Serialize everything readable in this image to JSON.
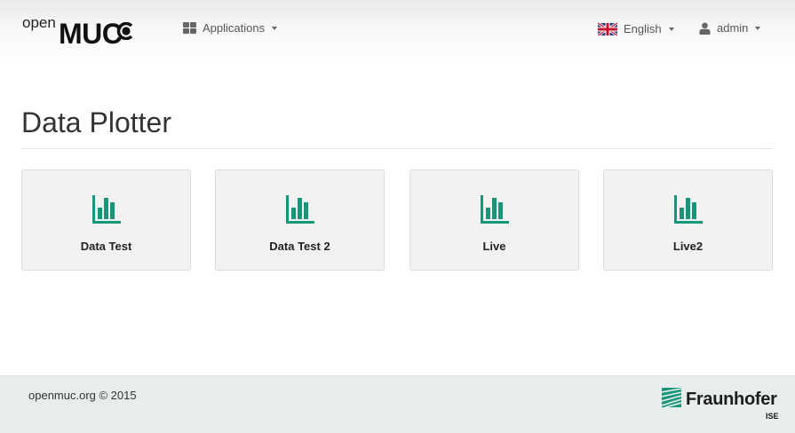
{
  "brand": {
    "prefix": "open",
    "name": "MUC"
  },
  "nav": {
    "applications_label": "Applications",
    "language_label": "English",
    "user_label": "admin"
  },
  "page": {
    "title": "Data Plotter"
  },
  "tiles": [
    {
      "label": "Data Test",
      "icon": "bar-chart-icon"
    },
    {
      "label": "Data Test 2",
      "icon": "bar-chart-icon"
    },
    {
      "label": "Live",
      "icon": "bar-chart-icon"
    },
    {
      "label": "Live2",
      "icon": "bar-chart-icon"
    }
  ],
  "footer": {
    "copyright": "openmuc.org © 2015",
    "org_name": "Fraunhofer",
    "org_unit": "ISE"
  },
  "colors": {
    "accent": "#17967c",
    "navbar": "#f0f0f0",
    "footer": "#e7ecec"
  }
}
